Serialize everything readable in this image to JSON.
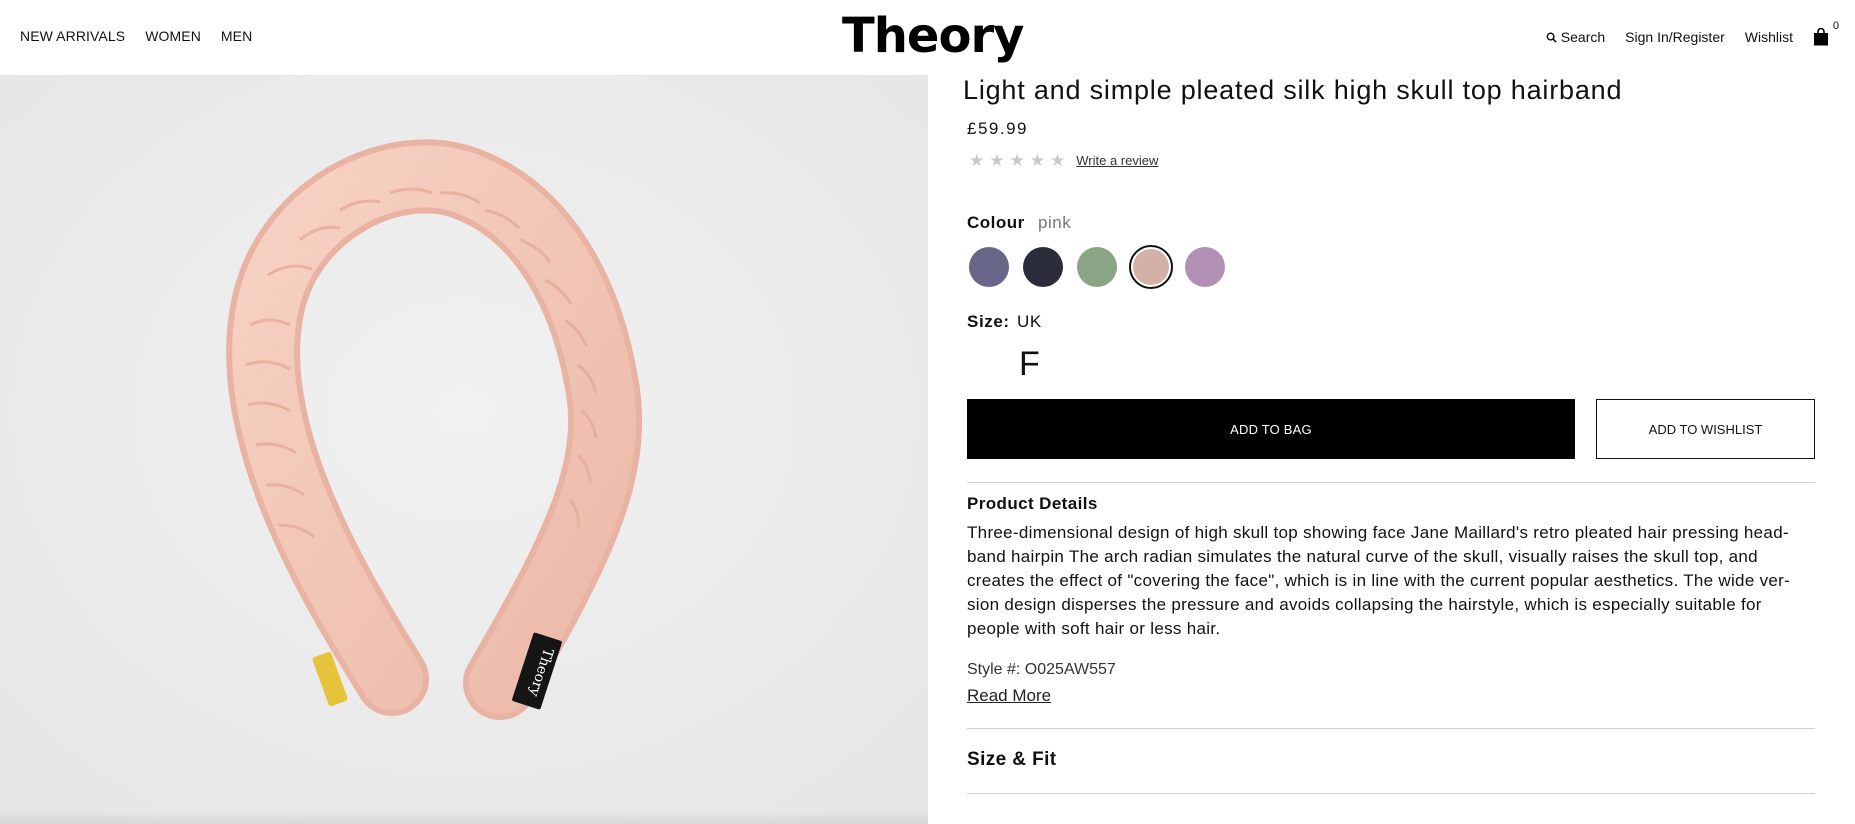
{
  "header": {
    "nav_left": [
      "NEW ARRIVALS",
      "WOMEN",
      "MEN"
    ],
    "logo": "Theory",
    "search_label": "Search",
    "signin_label": "Sign In/Register",
    "wishlist_label": "Wishlist",
    "bag_count": "0"
  },
  "product": {
    "title": "Light and simple pleated silk high skull top hairband",
    "price": "£59.99",
    "rating": {
      "stars": 0,
      "max": 5
    },
    "review_link": "Write a review",
    "colour_label": "Colour",
    "colour_value": "pink",
    "swatches": [
      {
        "color": "#686688",
        "selected": false
      },
      {
        "color": "#2c2d3a",
        "selected": false
      },
      {
        "color": "#8ba486",
        "selected": false
      },
      {
        "color": "#d4b1a6",
        "selected": true
      },
      {
        "color": "#b290b4",
        "selected": false
      }
    ],
    "size_label": "Size:",
    "size_system": "UK",
    "size_option": "F",
    "add_to_bag": "ADD TO BAG",
    "add_to_wishlist": "ADD TO WISHLIST",
    "details_heading": "Product Details",
    "details_text": "Three-dimensional design of high skull top showing face Jane Maillard's retro pleated hair pressing head-band hairpin The arch radian simulates the natural curve of the skull, visually raises the skull top, and creates the effect of \"covering the face\", which is in line with the current popular aesthetics. The wide ver-sion design disperses the pressure and avoids collapsing the hairstyle, which is especially suitable for people with soft hair or less hair.",
    "style_number": "Style #: O025AW557",
    "read_more": "Read More",
    "size_fit_heading": "Size & Fit",
    "image_tag_text": "Theory"
  },
  "colors": {
    "headband": "#f3c9bb",
    "headband_shadow": "#e3ad9c",
    "image_bg": "#ececec"
  }
}
